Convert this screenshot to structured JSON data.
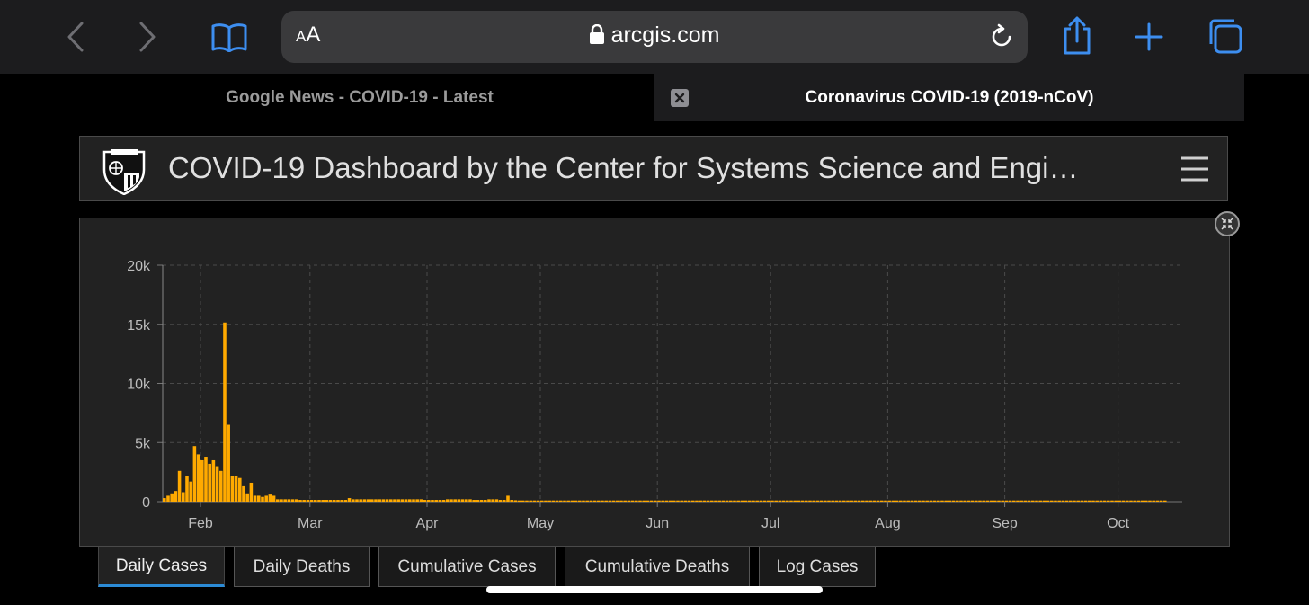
{
  "browser": {
    "text_size_label_small": "A",
    "text_size_label_large": "A",
    "url": "arcgis.com",
    "accent_color": "#3d8ef0"
  },
  "tabs": [
    {
      "label": "Google News - COVID-19 - Latest",
      "active": false
    },
    {
      "label": "Coronavirus COVID-19 (2019-nCoV)",
      "active": true
    }
  ],
  "dashboard": {
    "title": "COVID-19 Dashboard by the Center for Systems Science and Engi…"
  },
  "chart_data": {
    "type": "bar",
    "bar_color": "#ffaa00",
    "grid": true,
    "ylim": [
      0,
      20000
    ],
    "y_ticks": [
      {
        "value": 0,
        "label": "0"
      },
      {
        "value": 5000,
        "label": "5k"
      },
      {
        "value": 10000,
        "label": "10k"
      },
      {
        "value": 15000,
        "label": "15k"
      },
      {
        "value": 20000,
        "label": "20k"
      }
    ],
    "x_ticks": [
      "Feb",
      "Mar",
      "Apr",
      "May",
      "Jun",
      "Jul",
      "Aug",
      "Sep",
      "Oct"
    ],
    "x_range": [
      "2020-01-22",
      "2020-10-18"
    ],
    "values": [
      300,
      500,
      700,
      900,
      2600,
      800,
      2200,
      1700,
      4700,
      4000,
      3500,
      3800,
      3200,
      3500,
      3000,
      2600,
      15150,
      6500,
      2200,
      2200,
      2000,
      1300,
      700,
      1600,
      500,
      500,
      400,
      500,
      600,
      500,
      200,
      200,
      200,
      200,
      200,
      200,
      150,
      150,
      150,
      150,
      150,
      150,
      150,
      150,
      150,
      150,
      150,
      150,
      150,
      300,
      200,
      200,
      200,
      200,
      200,
      200,
      200,
      200,
      200,
      200,
      200,
      200,
      200,
      200,
      200,
      200,
      200,
      200,
      200,
      150,
      150,
      150,
      150,
      150,
      150,
      200,
      200,
      200,
      200,
      200,
      200,
      200,
      150,
      150,
      150,
      150,
      200,
      200,
      200,
      150,
      150,
      500,
      150,
      120,
      100,
      100,
      100,
      100,
      100,
      100,
      100,
      100,
      100,
      100,
      100,
      100,
      100,
      100,
      100,
      100,
      100,
      100,
      100,
      100,
      100,
      100,
      100,
      100,
      100,
      100,
      100,
      100,
      100,
      100,
      100,
      100,
      100,
      100,
      100,
      100,
      100,
      100,
      100,
      100,
      100,
      100,
      100,
      100,
      100,
      100,
      100,
      100,
      100,
      100,
      100,
      100,
      100,
      100,
      100,
      100,
      100,
      100,
      100,
      100,
      100,
      100,
      100,
      100,
      100,
      100,
      100,
      100,
      100,
      100,
      100,
      100,
      100,
      100,
      100,
      100,
      100,
      100,
      100,
      100,
      100,
      100,
      100,
      100,
      100,
      100,
      100,
      100,
      100,
      100,
      100,
      100,
      100,
      100,
      100,
      100,
      100,
      100,
      100,
      100,
      100,
      100,
      100,
      100,
      100,
      100,
      100,
      100,
      100,
      100,
      100,
      100,
      100,
      100,
      100,
      100,
      100,
      100,
      100,
      100,
      100,
      100,
      100,
      100,
      100,
      100,
      100,
      100,
      100,
      100,
      100,
      100,
      100,
      100,
      100,
      100,
      100,
      100,
      100,
      100,
      100,
      100,
      100,
      100,
      100,
      100,
      100,
      100,
      100,
      100,
      100,
      100,
      100,
      100,
      100,
      100,
      100,
      100,
      100,
      100,
      100,
      100,
      100,
      100,
      100,
      100,
      100,
      100,
      100,
      100,
      100,
      100
    ]
  },
  "chart_tabs": [
    {
      "label": "Daily Cases",
      "active": true
    },
    {
      "label": "Daily Deaths",
      "active": false
    },
    {
      "label": "Cumulative Cases",
      "active": false
    },
    {
      "label": "Cumulative Deaths",
      "active": false
    },
    {
      "label": "Log Cases",
      "active": false
    }
  ]
}
